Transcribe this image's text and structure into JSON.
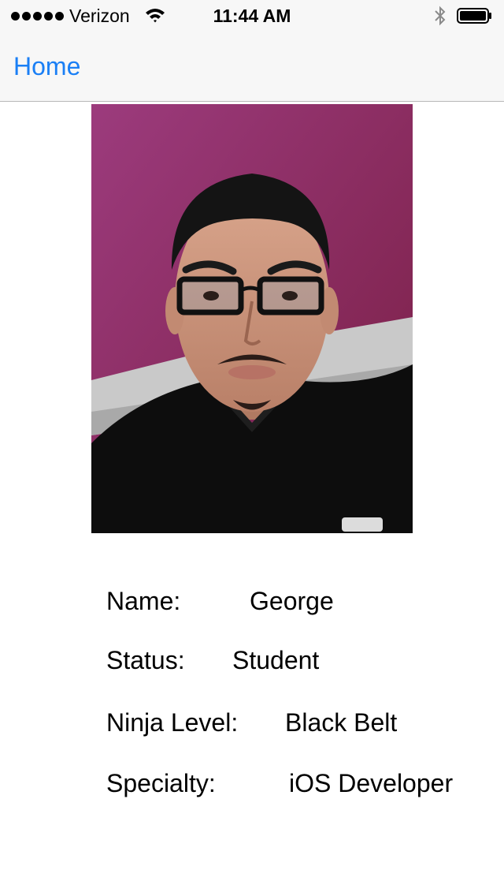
{
  "status_bar": {
    "carrier": "Verizon",
    "time": "11:44 AM",
    "signal_bars": 5,
    "wifi_icon": "wifi-icon",
    "bluetooth_icon": "bluetooth-icon",
    "battery_icon": "battery-icon"
  },
  "nav": {
    "back_label": "Home"
  },
  "profile": {
    "photo_icon": "profile-photo",
    "colors": {
      "wall": "#8a2a5a",
      "shirt": "#0d0d0d",
      "accent": "#1a7ff5"
    }
  },
  "info": {
    "name_label": "Name:",
    "name_value": "George",
    "status_label": "Status:",
    "status_value": "Student",
    "level_label": "Ninja Level:",
    "level_value": "Black Belt",
    "specialty_label": "Specialty:",
    "specialty_value": "iOS Developer"
  }
}
